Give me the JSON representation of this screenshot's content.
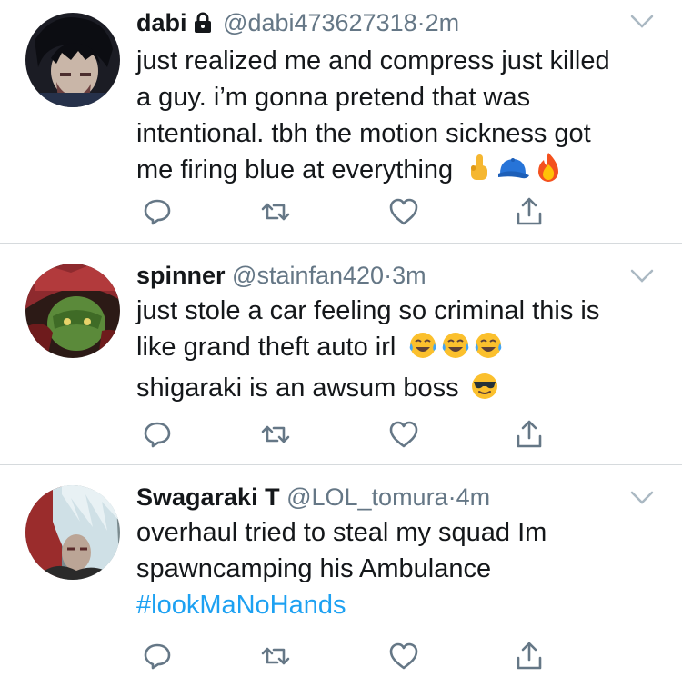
{
  "tweets": [
    {
      "name": "dabi",
      "handle": "@dabi473627318",
      "separator": "·",
      "time": "2m",
      "lines": [
        "just realized me and compress just killed",
        "a guy. i’m gonna pretend that was",
        "intentional. tbh the motion sickness got",
        "me firing blue at everything"
      ],
      "emojis": [
        "middle-finger",
        "blue-cap",
        "fire"
      ]
    },
    {
      "name": "spinner",
      "handle": "@stainfan420",
      "separator": "·",
      "time": "3m",
      "lines": [
        "just stole a car feeling so criminal this is",
        "like grand theft auto irl",
        "shigaraki is an awsum boss"
      ],
      "emojis": [
        "tears-of-joy",
        "tears-of-joy",
        "tears-of-joy",
        "sunglasses"
      ]
    },
    {
      "name": "Swagaraki T",
      "handle": "@LOL_tomura",
      "separator": "·",
      "time": "4m",
      "lines": [
        "overhaul tried to steal my squad Im",
        "spawncamping his Ambulance"
      ],
      "hashtag": "#lookMaNoHands"
    }
  ],
  "icons": [
    "reply-icon",
    "retweet-icon",
    "like-icon",
    "share-icon",
    "chevron-down-icon",
    "lock-icon"
  ],
  "colors": {
    "text": "#14171a",
    "muted": "#657786",
    "link": "#1da1f2",
    "divider": "#d6dadd"
  }
}
